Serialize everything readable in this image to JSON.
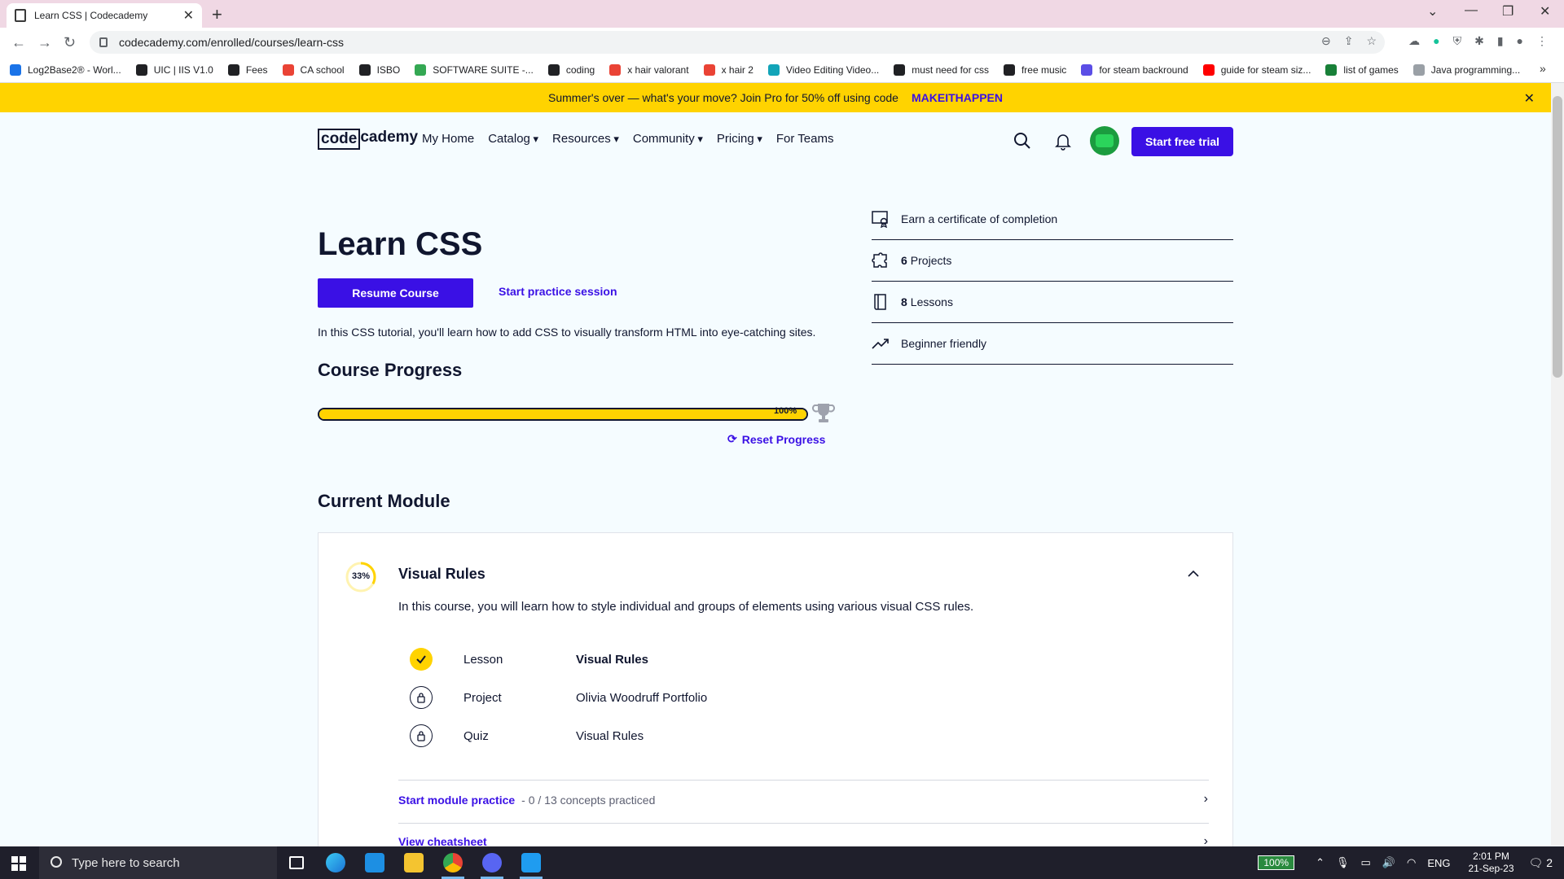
{
  "browser": {
    "tab_title": "Learn CSS | Codecademy",
    "url": "codecademy.com/enrolled/courses/learn-css",
    "bookmarks": [
      {
        "label": "Log2Base2® - Worl...",
        "color": "#1a73e8"
      },
      {
        "label": "UIC | IIS V1.0",
        "color": "#202124"
      },
      {
        "label": "Fees",
        "color": "#202124"
      },
      {
        "label": "CA school",
        "color": "#ea4335"
      },
      {
        "label": "ISBO",
        "color": "#202124"
      },
      {
        "label": "SOFTWARE SUITE -...",
        "color": "#34a853"
      },
      {
        "label": "coding",
        "color": "#202124"
      },
      {
        "label": "x hair valorant",
        "color": "#ea4335"
      },
      {
        "label": "x hair 2",
        "color": "#ea4335"
      },
      {
        "label": "Video Editing Video...",
        "color": "#12a4b8"
      },
      {
        "label": "must need for css",
        "color": "#202124"
      },
      {
        "label": "free music",
        "color": "#202124"
      },
      {
        "label": "for steam backround",
        "color": "#5b4ee6"
      },
      {
        "label": "guide for steam siz...",
        "color": "#ff0000"
      },
      {
        "label": "list of games",
        "color": "#188038"
      },
      {
        "label": "Java programming...",
        "color": "#9aa0a6"
      }
    ],
    "bookmarks_more": "»"
  },
  "promo": {
    "text": "Summer's over — what's your move? Join Pro for 50% off using code",
    "code": "MAKEITHAPPEN"
  },
  "header": {
    "logo_boxed": "code",
    "logo_rest": "cademy",
    "nav": [
      "My Home",
      "Catalog",
      "Resources",
      "Community",
      "Pricing",
      "For Teams"
    ],
    "trial_button": "Start free trial"
  },
  "course": {
    "title": "Learn CSS",
    "resume_button": "Resume Course",
    "practice_link": "Start practice session",
    "description": "In this CSS tutorial, you'll learn how to add CSS to visually transform HTML into eye-catching sites.",
    "progress_title": "Course Progress",
    "progress_value": 100,
    "progress_text": "100%",
    "reset_label": "Reset Progress"
  },
  "info": {
    "certificate": "Earn a certificate of completion",
    "projects_count": "6",
    "projects_label": "Projects",
    "lessons_count": "8",
    "lessons_label": "Lessons",
    "level": "Beginner friendly"
  },
  "module": {
    "heading": "Current Module",
    "percent": 33,
    "percent_text": "33%",
    "title": "Visual Rules",
    "description": "In this course, you will learn how to style individual and groups of elements using various visual CSS rules.",
    "items": [
      {
        "type": "Lesson",
        "name": "Visual Rules",
        "status": "done"
      },
      {
        "type": "Project",
        "name": "Olivia Woodruff Portfolio",
        "status": "locked"
      },
      {
        "type": "Quiz",
        "name": "Visual Rules",
        "status": "locked"
      }
    ],
    "practice_link": "Start module practice",
    "practice_sub": "- 0 / 13 concepts practiced",
    "cheatsheet_link": "View cheatsheet"
  },
  "taskbar": {
    "search_placeholder": "Type here to search",
    "battery": "100%",
    "lang": "ENG",
    "time": "2:01 PM",
    "date": "21-Sep-23",
    "notifications": "2"
  },
  "colors": {
    "brand": "#3a10e5",
    "promo": "#ffd300",
    "ink": "#10162f"
  }
}
